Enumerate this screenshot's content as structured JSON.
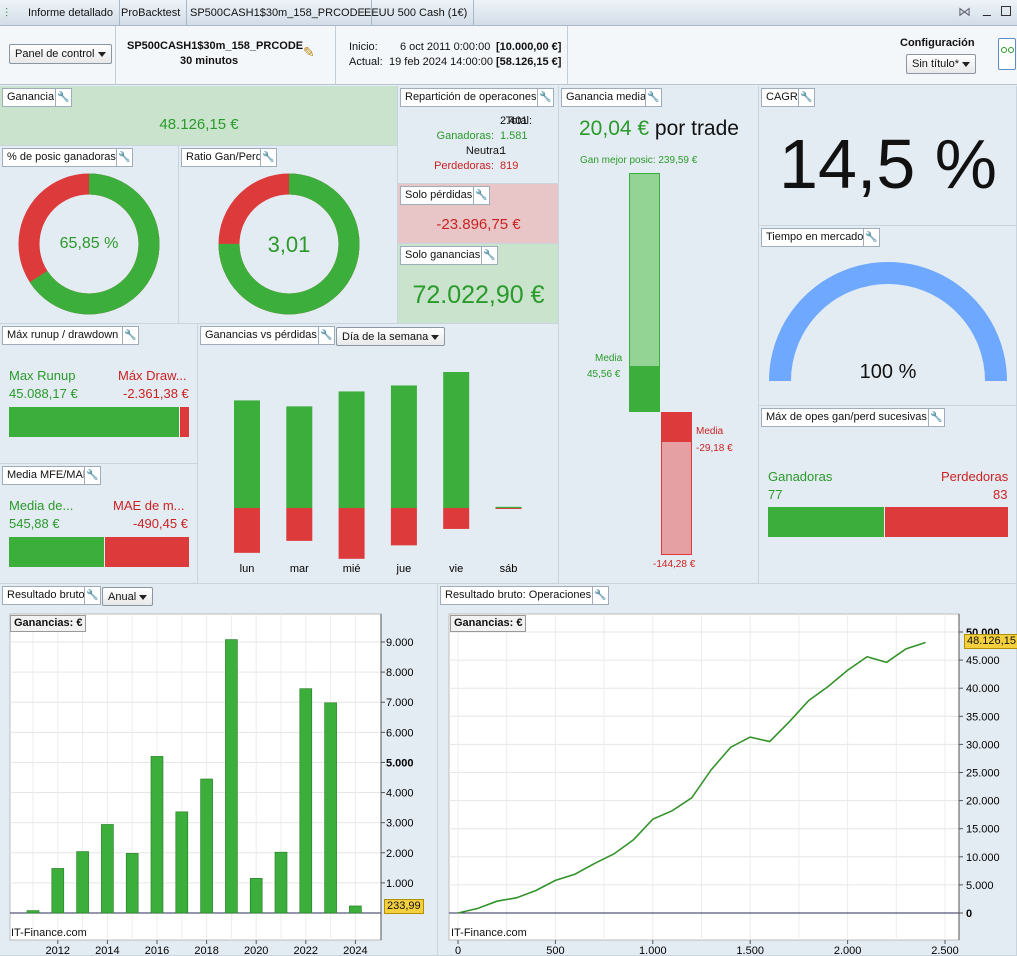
{
  "tabs": [
    {
      "label": "Informe detallado"
    },
    {
      "label": "ProBacktest"
    },
    {
      "label": "SP500CASH1$30m_158_PRCODE"
    },
    {
      "label": "EEUU 500 Cash (1€)"
    }
  ],
  "header": {
    "panel_label": "Panel de control",
    "strategy_name": "SP500CASH1$30m_158_PRCODE",
    "timeframe": "30 minutos",
    "inicio_label": "Inicio:",
    "inicio_date": "6 oct 2011 0:00:00",
    "inicio_value": "[10.000,00 €]",
    "actual_label": "Actual:",
    "actual_date": "19 feb 2024 14:00:00",
    "actual_value": "[58.126,15 €]",
    "config_label": "Configuración",
    "config_select": "Sin título*"
  },
  "ganancia": {
    "title": "Ganancia",
    "value": "48.126,15 €"
  },
  "pct_ganadoras": {
    "title": "% de posic ganadoras",
    "value": "65,85 %",
    "fraction": 0.6585
  },
  "ratio": {
    "title": "Ratio Gan/Perd",
    "value": "3,01",
    "fraction": 0.75
  },
  "reparticion": {
    "title": "Repartición de operacones",
    "total_label": "Total:",
    "total": "2.401",
    "gan_label": "Ganadoras:",
    "gan": "1.581",
    "neutra_label": "Neutra:",
    "neutra": "1",
    "perd_label": "Perdedoras:",
    "perd": "819"
  },
  "solo_perdidas": {
    "title": "Solo pérdidas",
    "value": "-23.896,75 €"
  },
  "solo_ganancias": {
    "title": "Solo ganancias",
    "value": "72.022,90 €"
  },
  "ganancia_media": {
    "title": "Ganancia media",
    "value": "20,04 €",
    "suffix": "por trade",
    "best_label": "Gan mejor posic:",
    "best": "239,59 €",
    "media_label": "Media",
    "media_gain": "45,56 €",
    "media_loss": "-29,18 €",
    "worst": "-144,28 €"
  },
  "cagr": {
    "title": "CAGR",
    "value": "14,5 %"
  },
  "tiempo": {
    "title": "Tiempo en mercado",
    "value": "100 %",
    "fraction": 1
  },
  "max_runup": {
    "title": "Máx runup / drawdown",
    "runup_label": "Max Runup",
    "runup": "45.088,17 €",
    "dd_label": "Máx Draw...",
    "dd": "-2.361,38 €"
  },
  "gvp": {
    "title": "Ganancias vs pérdidas",
    "select": "Día de la semana",
    "days": [
      "lun",
      "mar",
      "mié",
      "jue",
      "vie",
      "sáb"
    ]
  },
  "mfe": {
    "title": "Media MFE/MAE",
    "mfe_label": "Media de...",
    "mfe": "545,88 €",
    "mae_label": "MAE de m...",
    "mae": "-490,45 €"
  },
  "sucesivas": {
    "title": "Máx de opes gan/perd sucesivas",
    "gan_label": "Ganadoras",
    "gan": "77",
    "perd_label": "Perdedoras",
    "perd": "83"
  },
  "bruto": {
    "title": "Resultado bruto",
    "select": "Anual",
    "legend": "Ganancias: €",
    "watermark": "IT-Finance.com",
    "last_value": "233,99"
  },
  "bruto_ops": {
    "title": "Resultado bruto: Operaciones",
    "legend": "Ganancias: €",
    "watermark": "IT-Finance.com",
    "last_value": "48.126,15"
  },
  "colors": {
    "green": "#3cae3c",
    "red": "#dd3b3b",
    "blue": "#6fa8ff"
  },
  "chart_data": [
    {
      "type": "bar",
      "categories": [
        "2011",
        "2012",
        "2013",
        "2014",
        "2015",
        "2016",
        "2017",
        "2018",
        "2019",
        "2020",
        "2021",
        "2022",
        "2023",
        "2024"
      ],
      "values": [
        80,
        1480,
        2040,
        2940,
        1980,
        5200,
        3360,
        4450,
        9080,
        1150,
        2020,
        7450,
        6980,
        233.99
      ],
      "xticks": [
        "2012",
        "2014",
        "2016",
        "2018",
        "2020",
        "2022",
        "2024"
      ],
      "yticks": [
        "9.000",
        "8.000",
        "7.000",
        "6.000",
        "5.000",
        "4.000",
        "3.000",
        "2.000",
        "1.000"
      ],
      "ylim": [
        0,
        9700
      ]
    },
    {
      "type": "line",
      "x": [
        0,
        100,
        200,
        300,
        400,
        500,
        600,
        700,
        800,
        900,
        1000,
        1100,
        1200,
        1300,
        1400,
        1500,
        1600,
        1700,
        1800,
        1900,
        2000,
        2100,
        2200,
        2300,
        2400
      ],
      "y": [
        0,
        800,
        2100,
        2700,
        4000,
        5800,
        6900,
        8800,
        10500,
        13000,
        16700,
        18200,
        20500,
        25500,
        29500,
        31300,
        30500,
        34000,
        37800,
        40300,
        43200,
        45600,
        44600,
        47000,
        48126
      ],
      "xticks": [
        "0",
        "500",
        "1.000",
        "1.500",
        "2.000",
        "2.500"
      ],
      "yticks": [
        "50.000",
        "45.000",
        "40.000",
        "35.000",
        "30.000",
        "25.000",
        "20.000",
        "15.000",
        "10.000",
        "5.000",
        "0"
      ],
      "xlim": [
        0,
        2500
      ],
      "ylim": [
        -1000,
        50700
      ]
    },
    {
      "type": "bar",
      "name": "Ganancias vs pérdidas",
      "categories": [
        "lun",
        "mar",
        "mié",
        "jue",
        "vie",
        "sáb"
      ],
      "gains": [
        7200,
        6800,
        7800,
        8200,
        9100,
        80
      ],
      "losses": [
        -3000,
        -2200,
        -3400,
        -2500,
        -1400,
        -60
      ]
    }
  ]
}
